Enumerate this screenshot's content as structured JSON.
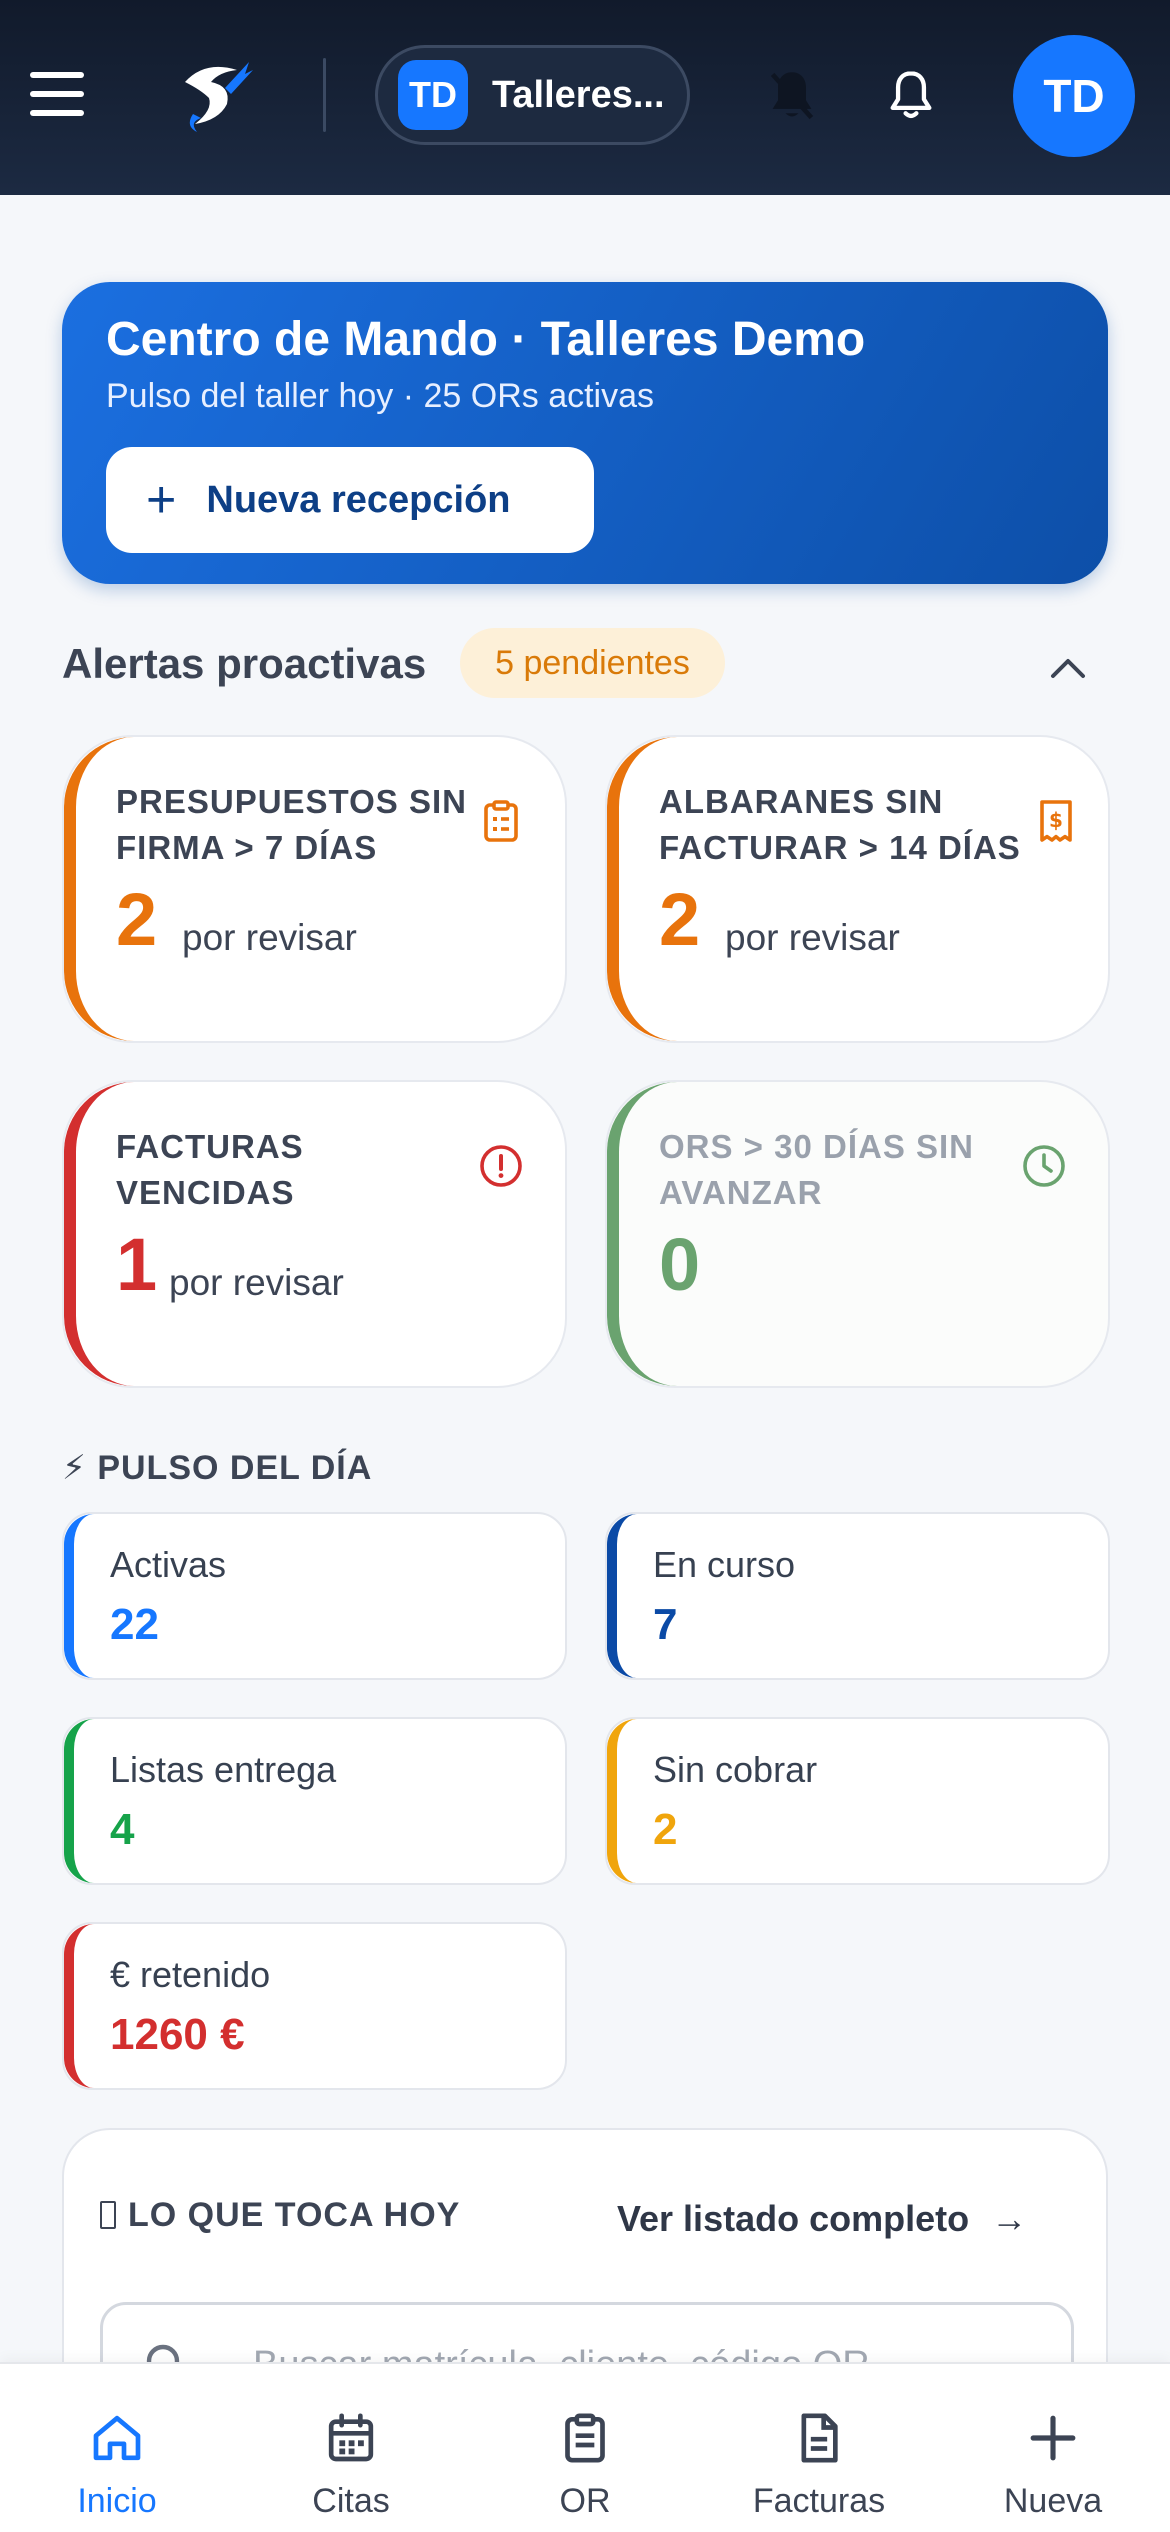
{
  "header": {
    "workspace_badge": "TD",
    "workspace_name": "Talleres...",
    "avatar_initials": "TD"
  },
  "hero": {
    "title": "Centro de Mando · Talleres Demo",
    "subtitle": "Pulso del taller hoy · 25 ORs activas",
    "button_label": "Nueva recepción",
    "button_plus": "+"
  },
  "alerts": {
    "title": "Alertas proactivas",
    "badge": "5 pendientes",
    "cards": [
      {
        "title": "PRESUPUESTOS SIN FIRMA > 7 DÍAS",
        "count": "2",
        "sub": "por revisar",
        "color": "#e8730c",
        "icon": "clipboard-icon"
      },
      {
        "title": "ALBARANES SIN FACTURAR > 14 DÍAS",
        "count": "2",
        "sub": "por revisar",
        "color": "#e8730c",
        "icon": "receipt-icon"
      },
      {
        "title": "FACTURAS VENCIDAS",
        "count": "1",
        "sub": "por revisar",
        "color": "#d32f2f",
        "icon": "alert-circle-icon"
      },
      {
        "title": "ORS > 30 DÍAS SIN AVANZAR",
        "count": "0",
        "sub": "",
        "color": "#6aa36f",
        "icon": "clock-icon"
      }
    ]
  },
  "pulse": {
    "title": "⚡ PULSO DEL DÍA",
    "cards": [
      {
        "label": "Activas",
        "value": "22",
        "color": "#1677ff"
      },
      {
        "label": "En curso",
        "value": "7",
        "color": "#0b4aa6"
      },
      {
        "label": "Listas entrega",
        "value": "4",
        "color": "#16a34a"
      },
      {
        "label": "Sin cobrar",
        "value": "2",
        "color": "#f0a50c"
      },
      {
        "label": "€ retenido",
        "value": "1260 €",
        "color": "#d32f2f"
      }
    ]
  },
  "today": {
    "title": "LO QUE TOCA HOY",
    "link": "Ver listado completo",
    "link_arrow": "→",
    "search_placeholder": "Buscar matrícula, cliente, código OR..."
  },
  "nav": {
    "items": [
      {
        "label": "Inicio",
        "icon": "home-icon"
      },
      {
        "label": "Citas",
        "icon": "calendar-icon"
      },
      {
        "label": "OR",
        "icon": "clipboard-icon"
      },
      {
        "label": "Facturas",
        "icon": "document-icon"
      },
      {
        "label": "Nueva",
        "icon": "plus-icon"
      }
    ]
  },
  "colors": {
    "header_bg": "#111a2b",
    "brand_blue": "#1677ff",
    "orange": "#e8730c",
    "red": "#d32f2f",
    "green": "#6aa36f"
  }
}
